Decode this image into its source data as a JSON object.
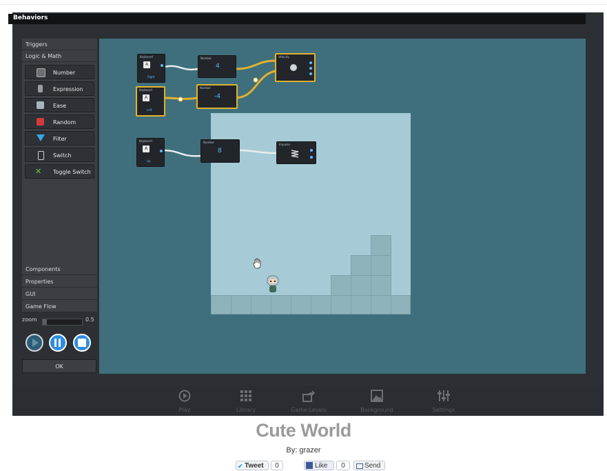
{
  "window": {
    "title": "Behaviors"
  },
  "sidebar": {
    "categories_top": [
      "Triggers",
      "Logic & Math"
    ],
    "items": [
      {
        "label": "Number",
        "icon": "number-icon",
        "color": "#6b6f74"
      },
      {
        "label": "Expression",
        "icon": "expression-icon",
        "color": "#8a8e93"
      },
      {
        "label": "Ease",
        "icon": "ease-icon",
        "color": "#a9b4bd"
      },
      {
        "label": "Random",
        "icon": "random-dice-icon",
        "color": "#d23a3a"
      },
      {
        "label": "Filter",
        "icon": "filter-icon",
        "color": "#3aa6e6"
      },
      {
        "label": "Switch",
        "icon": "switch-icon",
        "color": "#8a8e93"
      },
      {
        "label": "Toggle Switch",
        "icon": "toggle-switch-icon",
        "color": "#6fcf3a"
      }
    ],
    "categories_bottom": [
      "Components",
      "Properties",
      "GUI",
      "Game Flow"
    ]
  },
  "zoom": {
    "label": "zoom",
    "value": "0.5"
  },
  "controls": {
    "ok_label": "OK"
  },
  "nodes": [
    {
      "title": "Keyboard",
      "key": "A",
      "sub": "Right"
    },
    {
      "title": "Number",
      "value": "4"
    },
    {
      "title": "Velocity"
    },
    {
      "title": "Keyboard",
      "key": "A",
      "sub": "Left"
    },
    {
      "title": "Number",
      "value": "-4"
    },
    {
      "title": "Keyboard",
      "key": "A",
      "sub": "Up"
    },
    {
      "title": "Number",
      "value": "8"
    },
    {
      "title": "Impulse"
    }
  ],
  "toolbar": {
    "items": [
      {
        "label": "Play",
        "icon": "play-icon"
      },
      {
        "label": "Library",
        "icon": "grid-icon"
      },
      {
        "label": "Game Levels",
        "icon": "share-icon"
      },
      {
        "label": "Background",
        "icon": "image-icon"
      },
      {
        "label": "Settings",
        "icon": "sliders-icon"
      }
    ]
  },
  "game": {
    "title": "Cute World",
    "author": "By: grazer"
  },
  "social": {
    "tweet": "Tweet",
    "tweet_count": "0",
    "like": "Like",
    "like_count": "0",
    "send": "Send"
  },
  "colors": {
    "canvas": "#3f6f7c",
    "stage": "#a6cbd6",
    "accent": "#e0b22f",
    "link_blue": "#5fb6ff"
  }
}
